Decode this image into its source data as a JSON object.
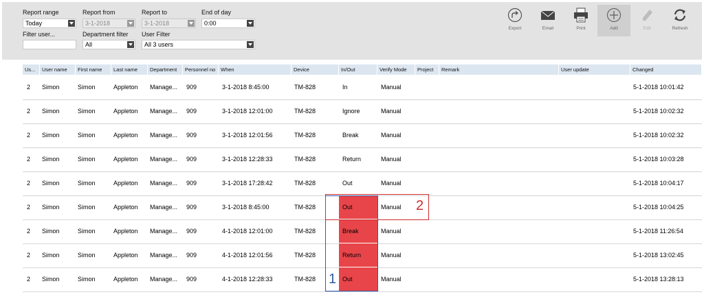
{
  "filters": {
    "report_range_label": "Report range",
    "report_range_value": "Today",
    "report_from_label": "Report from",
    "report_from_value": "3-1-2018",
    "report_to_label": "Report to",
    "report_to_value": "3-1-2018",
    "end_of_day_label": "End of day",
    "end_of_day_value": "0:00",
    "filter_user_label": "Filter user...",
    "department_filter_label": "Department filter",
    "department_filter_value": "All",
    "user_filter_label": "User Filter",
    "user_filter_value": "All 3 users"
  },
  "toolbar": {
    "export": "Export",
    "email": "Email",
    "print": "Print",
    "add": "Add",
    "edit": "Edit",
    "refresh": "Refresh"
  },
  "columns": [
    "Us...",
    "User name",
    "First name",
    "Last name",
    "Department",
    "Personnel no",
    "When",
    "Device",
    "In/Out",
    "Verify Mode",
    "Project",
    "Remark",
    "User update",
    "Changed"
  ],
  "rows": [
    [
      "2",
      "Simon",
      "Simon",
      "Appleton",
      "Manage...",
      "909",
      "3-1-2018 8:45:00",
      "TM-828",
      "In",
      "Manual",
      "",
      "",
      "",
      "5-1-2018 10:01:42"
    ],
    [
      "2",
      "Simon",
      "Simon",
      "Appleton",
      "Manage...",
      "909",
      "3-1-2018 12:01:00",
      "TM-828",
      "Ignore",
      "Manual",
      "",
      "",
      "",
      "5-1-2018 10:02:32"
    ],
    [
      "2",
      "Simon",
      "Simon",
      "Appleton",
      "Manage...",
      "909",
      "3-1-2018 12:01:56",
      "TM-828",
      "Break",
      "Manual",
      "",
      "",
      "",
      "5-1-2018 10:02:32"
    ],
    [
      "2",
      "Simon",
      "Simon",
      "Appleton",
      "Manage...",
      "909",
      "3-1-2018 12:28:33",
      "TM-828",
      "Return",
      "Manual",
      "",
      "",
      "",
      "5-1-2018 10:03:28"
    ],
    [
      "2",
      "Simon",
      "Simon",
      "Appleton",
      "Manage...",
      "909",
      "3-1-2018 17:28:42",
      "TM-828",
      "Out",
      "Manual",
      "",
      "",
      "",
      "5-1-2018 10:04:17"
    ],
    [
      "2",
      "Simon",
      "Simon",
      "Appleton",
      "Manage...",
      "909",
      "3-1-2018 8:45:00",
      "TM-828",
      "Out",
      "Manual",
      "",
      "",
      "",
      "5-1-2018 10:04:25"
    ],
    [
      "2",
      "Simon",
      "Simon",
      "Appleton",
      "Manage...",
      "909",
      "4-1-2018 12:01:00",
      "TM-828",
      "Break",
      "Manual",
      "",
      "",
      "",
      "5-1-2018 11:26:54"
    ],
    [
      "2",
      "Simon",
      "Simon",
      "Appleton",
      "Manage...",
      "909",
      "4-1-2018 12:01:56",
      "TM-828",
      "Return",
      "Manual",
      "",
      "",
      "",
      "5-1-2018 13:02:45"
    ],
    [
      "2",
      "Simon",
      "Simon",
      "Appleton",
      "Manage...",
      "909",
      "4-1-2018 12:28:33",
      "TM-828",
      "Out",
      "Manual",
      "",
      "",
      "",
      "5-1-2018 13:28:13"
    ]
  ],
  "highlighted_rows": [
    5,
    6,
    7,
    8
  ],
  "annotations": {
    "blue_label": "1",
    "red_label": "2"
  },
  "colors": {
    "highlight": "#e8454a",
    "header_bg": "#dce6f0",
    "toolbar_bg": "#e3e3e3",
    "annotation_blue": "#2f5aa6",
    "annotation_red": "#cc2b2b"
  }
}
